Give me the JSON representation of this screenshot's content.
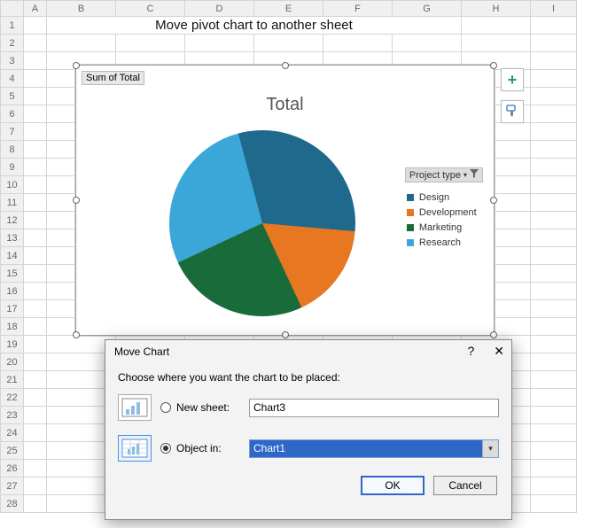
{
  "cols": [
    "A",
    "B",
    "C",
    "D",
    "E",
    "F",
    "G",
    "H",
    "I"
  ],
  "title": "Move pivot chart to another sheet",
  "chart": {
    "sum_label": "Sum of Total",
    "title": "Total",
    "legend_header": "Project type",
    "legend": [
      {
        "label": "Design",
        "color": "#1f6a8c"
      },
      {
        "label": "Development",
        "color": "#e87722"
      },
      {
        "label": "Marketing",
        "color": "#1a6b3a"
      },
      {
        "label": "Research",
        "color": "#3ba7d9"
      }
    ]
  },
  "chart_data": {
    "type": "pie",
    "title": "Total",
    "categories": [
      "Design",
      "Development",
      "Marketing",
      "Research"
    ],
    "values": [
      31,
      17,
      25,
      27
    ],
    "colors": [
      "#1f6a8c",
      "#e87722",
      "#1a6b3a",
      "#3ba7d9"
    ],
    "legend_title": "Project type",
    "legend_position": "right",
    "value_unit": "percent_estimated"
  },
  "dialog": {
    "title": "Move Chart",
    "help_glyph": "?",
    "close_glyph": "✕",
    "prompt": "Choose where you want the chart to be placed:",
    "new_sheet_label": "New sheet:",
    "new_sheet_value": "Chart3",
    "object_in_label": "Object in:",
    "object_in_value": "Chart1",
    "ok": "OK",
    "cancel": "Cancel"
  }
}
